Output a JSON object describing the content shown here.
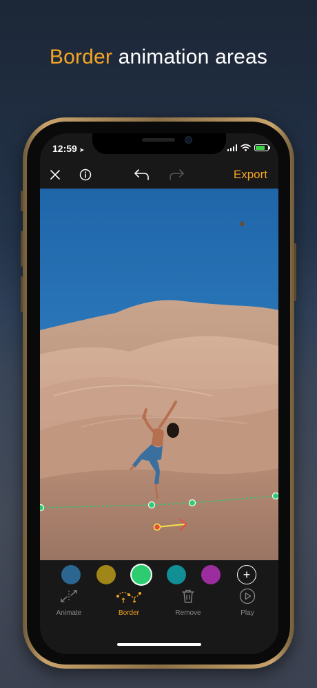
{
  "headline": {
    "accent": "Border",
    "rest": " animation areas"
  },
  "status": {
    "time": "12:59",
    "battery_level": 0.78
  },
  "toolbar": {
    "export_label": "Export",
    "icons": [
      "close-icon",
      "info-icon",
      "undo-icon",
      "redo-icon"
    ],
    "redo_enabled": false
  },
  "colors": {
    "swatches": [
      "#2a6690",
      "#a08519",
      "#2ecc71",
      "#108f94",
      "#9b2d9e"
    ],
    "selected_index": 2
  },
  "tabs": [
    {
      "label": "Animate",
      "icon": "animate-icon",
      "active": false
    },
    {
      "label": "Border",
      "icon": "border-icon",
      "active": true
    },
    {
      "label": "Remove",
      "icon": "trash-icon",
      "active": false
    },
    {
      "label": "Play",
      "icon": "play-icon",
      "active": false
    }
  ],
  "accent_color": "#f5a524"
}
